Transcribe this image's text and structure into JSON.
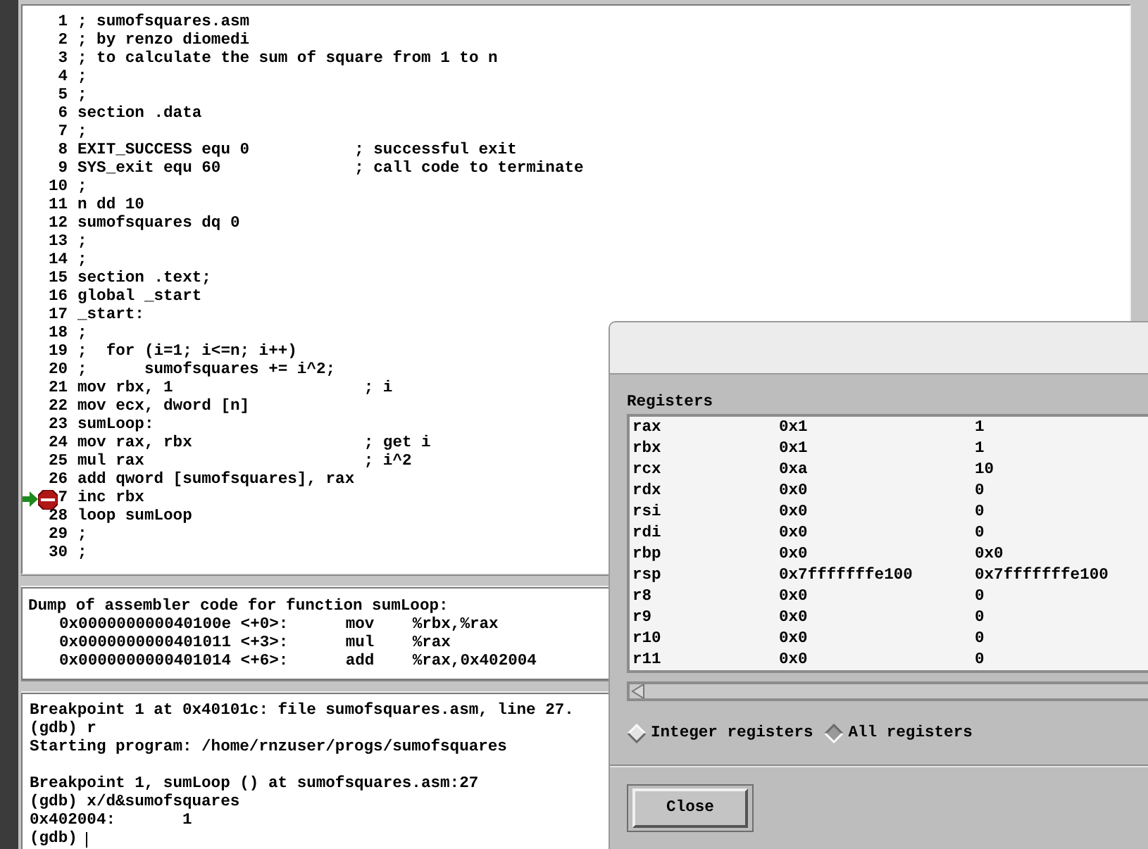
{
  "source": {
    "lines": [
      {
        "number": "1",
        "text": "; sumofsquares.asm",
        "breakpoint": false,
        "current": false
      },
      {
        "number": "2",
        "text": "; by renzo diomedi",
        "breakpoint": false,
        "current": false
      },
      {
        "number": "3",
        "text": "; to calculate the sum of square from 1 to n",
        "breakpoint": false,
        "current": false
      },
      {
        "number": "4",
        "text": ";",
        "breakpoint": false,
        "current": false
      },
      {
        "number": "5",
        "text": ";",
        "breakpoint": false,
        "current": false
      },
      {
        "number": "6",
        "text": "section .data",
        "breakpoint": false,
        "current": false
      },
      {
        "number": "7",
        "text": ";",
        "breakpoint": false,
        "current": false
      },
      {
        "number": "8",
        "text": "EXIT_SUCCESS equ 0           ; successful exit",
        "breakpoint": false,
        "current": false
      },
      {
        "number": "9",
        "text": "SYS_exit equ 60              ; call code to terminate",
        "breakpoint": false,
        "current": false
      },
      {
        "number": "10",
        "text": ";",
        "breakpoint": false,
        "current": false
      },
      {
        "number": "11",
        "text": "n dd 10",
        "breakpoint": false,
        "current": false
      },
      {
        "number": "12",
        "text": "sumofsquares dq 0",
        "breakpoint": false,
        "current": false
      },
      {
        "number": "13",
        "text": ";",
        "breakpoint": false,
        "current": false
      },
      {
        "number": "14",
        "text": ";",
        "breakpoint": false,
        "current": false
      },
      {
        "number": "15",
        "text": "section .text;",
        "breakpoint": false,
        "current": false
      },
      {
        "number": "16",
        "text": "global _start",
        "breakpoint": false,
        "current": false
      },
      {
        "number": "17",
        "text": "_start:",
        "breakpoint": false,
        "current": false
      },
      {
        "number": "18",
        "text": ";",
        "breakpoint": false,
        "current": false
      },
      {
        "number": "19",
        "text": ";  for (i=1; i<=n; i++)",
        "breakpoint": false,
        "current": false
      },
      {
        "number": "20",
        "text": ";      sumofsquares += i^2;",
        "breakpoint": false,
        "current": false
      },
      {
        "number": "21",
        "text": "mov rbx, 1                    ; i",
        "breakpoint": false,
        "current": false
      },
      {
        "number": "22",
        "text": "mov ecx, dword [n]",
        "breakpoint": false,
        "current": false
      },
      {
        "number": "23",
        "text": "sumLoop:",
        "breakpoint": false,
        "current": false
      },
      {
        "number": "24",
        "text": "mov rax, rbx                  ; get i",
        "breakpoint": false,
        "current": false
      },
      {
        "number": "25",
        "text": "mul rax                       ; i^2",
        "breakpoint": false,
        "current": false
      },
      {
        "number": "26",
        "text": "add qword [sumofsquares], rax",
        "breakpoint": false,
        "current": false
      },
      {
        "number": "7",
        "text": "inc rbx",
        "breakpoint": true,
        "current": true
      },
      {
        "number": "28",
        "text": "loop sumLoop",
        "breakpoint": false,
        "current": false
      },
      {
        "number": "29",
        "text": ";",
        "breakpoint": false,
        "current": false
      },
      {
        "number": "30",
        "text": ";",
        "breakpoint": false,
        "current": false
      }
    ]
  },
  "disassembly": {
    "header": "Dump of assembler code for function sumLoop:",
    "rows": [
      {
        "address": "0x000000000040100e",
        "offset": "<+0>:",
        "mnemonic": "mov",
        "operands": "%rbx,%rax"
      },
      {
        "address": "0x0000000000401011",
        "offset": "<+3>:",
        "mnemonic": "mul",
        "operands": "%rax"
      },
      {
        "address": "0x0000000000401014",
        "offset": "<+6>:",
        "mnemonic": "add",
        "operands": "%rax,0x402004"
      }
    ]
  },
  "console": {
    "blocks": [
      {
        "lines": [
          "Breakpoint 1 at 0x40101c: file sumofsquares.asm, line 27.",
          "(gdb) r",
          "Starting program: /home/rnzuser/progs/sumofsquares"
        ]
      },
      {
        "lines": [
          "Breakpoint 1, sumLoop () at sumofsquares.asm:27",
          "(gdb) x/d&sumofsquares",
          "0x402004:       1"
        ]
      }
    ],
    "prompt": "(gdb)"
  },
  "registers_dialog": {
    "heading": "Registers",
    "rows": [
      {
        "name": "rax",
        "hex": "0x1",
        "natural": "1"
      },
      {
        "name": "rbx",
        "hex": "0x1",
        "natural": "1"
      },
      {
        "name": "rcx",
        "hex": "0xa",
        "natural": "10"
      },
      {
        "name": "rdx",
        "hex": "0x0",
        "natural": "0"
      },
      {
        "name": "rsi",
        "hex": "0x0",
        "natural": "0"
      },
      {
        "name": "rdi",
        "hex": "0x0",
        "natural": "0"
      },
      {
        "name": "rbp",
        "hex": "0x0",
        "natural": "0x0"
      },
      {
        "name": "rsp",
        "hex": "0x7fffffffe100",
        "natural": "0x7fffffffe100"
      },
      {
        "name": "r8",
        "hex": "0x0",
        "natural": "0"
      },
      {
        "name": "r9",
        "hex": "0x0",
        "natural": "0"
      },
      {
        "name": "r10",
        "hex": "0x0",
        "natural": "0"
      },
      {
        "name": "r11",
        "hex": "0x0",
        "natural": "0"
      }
    ],
    "options": [
      {
        "label": "Integer registers",
        "selected": false
      },
      {
        "label": "All registers",
        "selected": true
      }
    ],
    "close_button": "Close"
  }
}
